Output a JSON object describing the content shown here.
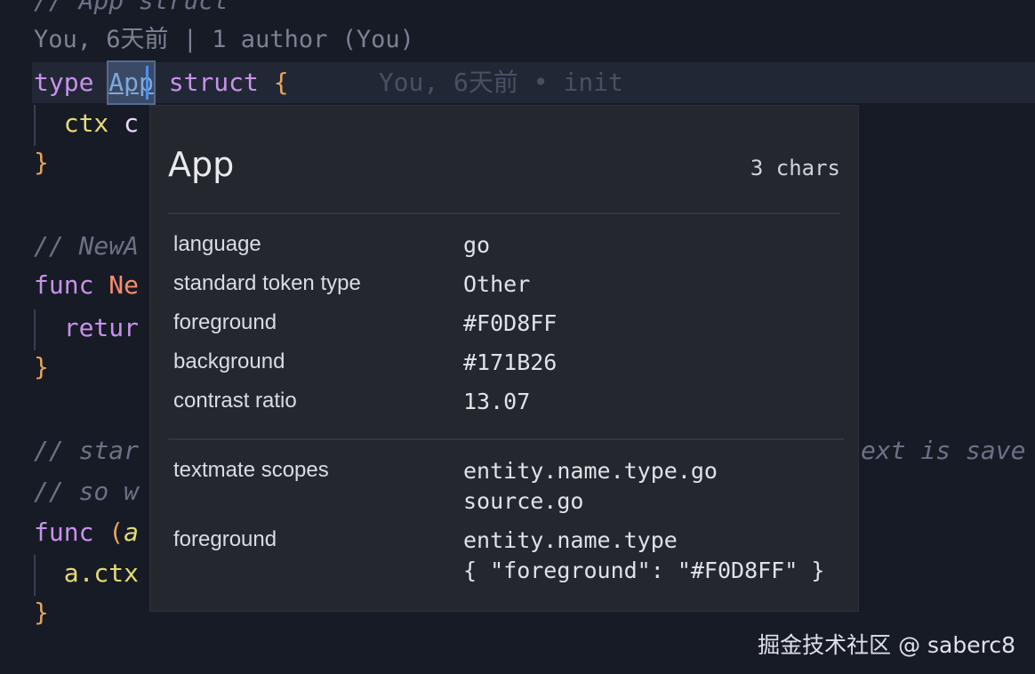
{
  "code": {
    "top_comment": "// App struct",
    "blame_header": "You, 6天前 | 1 author (You)",
    "line_type_kw": "type",
    "line_type_name": "App",
    "line_struct_kw": "struct",
    "line_open_brace": "{",
    "inline_blame": "You, 6天前 • init",
    "field_ctx": "ctx",
    "field_rest": "c",
    "close_brace": "}",
    "comment_newapp": "// NewA",
    "func_kw": "func",
    "func_name": "Ne",
    "return_kw": "retur",
    "comment_start": "// star",
    "comment_start_tail": "ext is save",
    "comment_so": "// so w",
    "func_kw2": "func",
    "func_paren": "(",
    "func_recv": "a",
    "actx": "a.ctx"
  },
  "hover": {
    "title": "App",
    "char_count": "3 chars",
    "rows": [
      {
        "key": "language",
        "value": "go"
      },
      {
        "key": "standard token type",
        "value": "Other"
      },
      {
        "key": "foreground",
        "value": "#F0D8FF"
      },
      {
        "key": "background",
        "value": "#171B26"
      },
      {
        "key": "contrast ratio",
        "value": "13.07"
      }
    ],
    "scopes_label": "textmate scopes",
    "scopes": [
      "entity.name.type.go",
      "source.go"
    ],
    "fg_label": "foreground",
    "fg_rule": "entity.name.type",
    "fg_json": "{ \"foreground\": \"#F0D8FF\" }"
  },
  "watermark": "掘金技术社区 @ saberc8",
  "colors": {
    "background": "#171B26",
    "foreground": "#F0D8FF"
  }
}
